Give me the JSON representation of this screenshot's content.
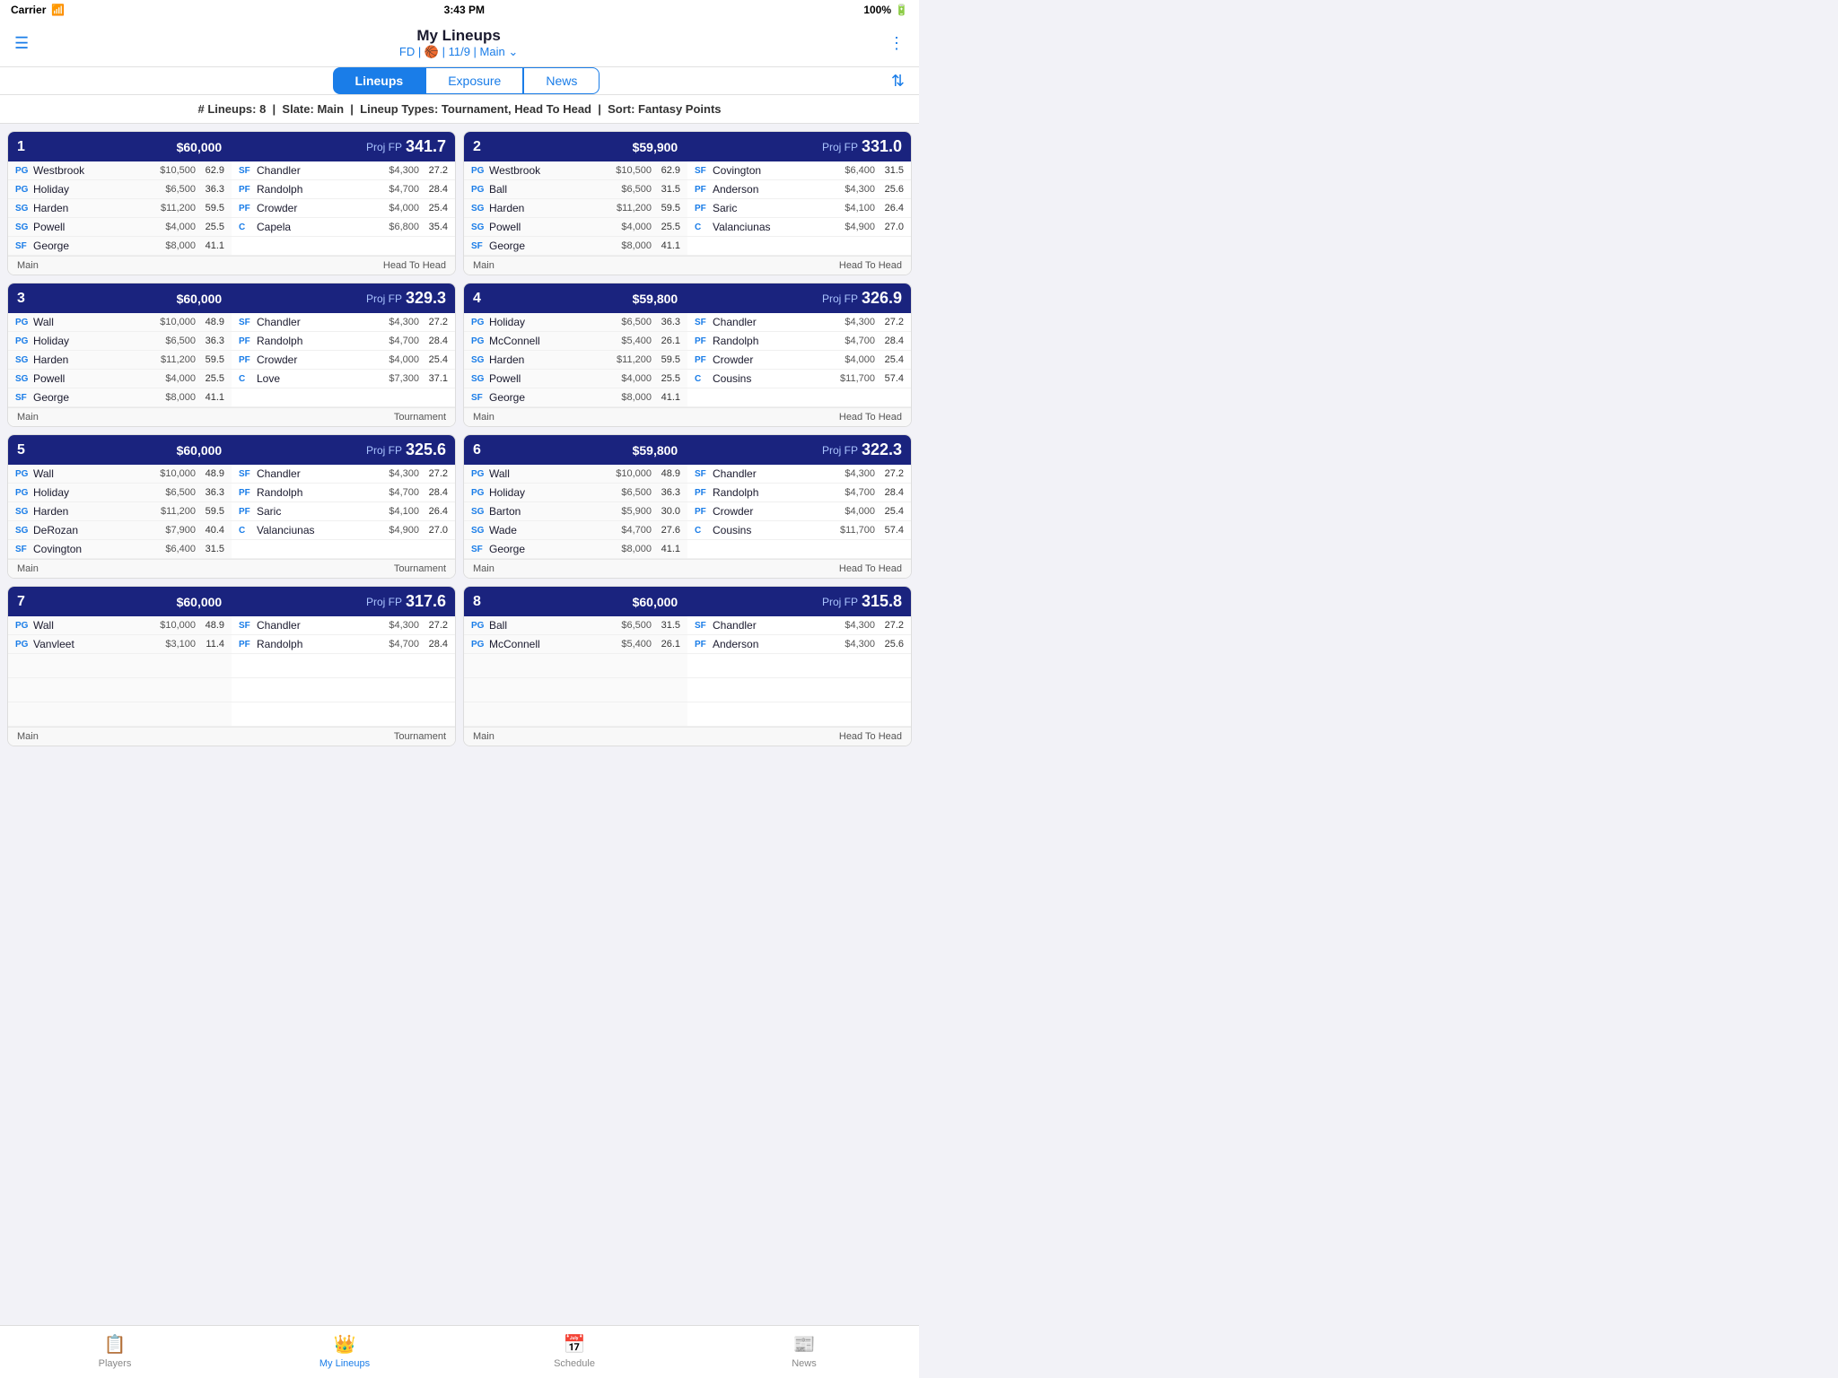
{
  "statusBar": {
    "carrier": "Carrier",
    "time": "3:43 PM",
    "battery": "100%"
  },
  "header": {
    "title": "My Lineups",
    "subtitle": "FD | 🏀 | 11/9 | Main ⌄",
    "menuIcon": "☰",
    "moreIcon": "⋮"
  },
  "tabs": [
    {
      "label": "Lineups",
      "active": true
    },
    {
      "label": "Exposure",
      "active": false
    },
    {
      "label": "News",
      "active": false
    }
  ],
  "filterBar": "# Lineups: 8  |  Slate: Main  |  Lineup Types: Tournament, Head To Head  |  Sort: Fantasy Points",
  "lineups": [
    {
      "num": "1",
      "salary": "$60,000",
      "projFP": "341.7",
      "players": [
        {
          "pos": "PG",
          "name": "Westbrook",
          "salary": "$10,500",
          "fp": "62.9"
        },
        {
          "pos": "PG",
          "name": "Holiday",
          "salary": "$6,500",
          "fp": "36.3"
        },
        {
          "pos": "SG",
          "name": "Harden",
          "salary": "$11,200",
          "fp": "59.5"
        },
        {
          "pos": "SG",
          "name": "Powell",
          "salary": "$4,000",
          "fp": "25.5"
        },
        {
          "pos": "SF",
          "name": "George",
          "salary": "$8,000",
          "fp": "41.1"
        },
        {
          "pos": "SF",
          "name": "Chandler",
          "salary": "$4,300",
          "fp": "27.2"
        },
        {
          "pos": "PF",
          "name": "Randolph",
          "salary": "$4,700",
          "fp": "28.4"
        },
        {
          "pos": "PF",
          "name": "Crowder",
          "salary": "$4,000",
          "fp": "25.4"
        },
        {
          "pos": "C",
          "name": "Capela",
          "salary": "$6,800",
          "fp": "35.4"
        }
      ],
      "slate": "Main",
      "type": "Head To Head"
    },
    {
      "num": "2",
      "salary": "$59,900",
      "projFP": "331.0",
      "players": [
        {
          "pos": "PG",
          "name": "Westbrook",
          "salary": "$10,500",
          "fp": "62.9"
        },
        {
          "pos": "PG",
          "name": "Ball",
          "salary": "$6,500",
          "fp": "31.5"
        },
        {
          "pos": "SG",
          "name": "Harden",
          "salary": "$11,200",
          "fp": "59.5"
        },
        {
          "pos": "SG",
          "name": "Powell",
          "salary": "$4,000",
          "fp": "25.5"
        },
        {
          "pos": "SF",
          "name": "George",
          "salary": "$8,000",
          "fp": "41.1"
        },
        {
          "pos": "SF",
          "name": "Covington",
          "salary": "$6,400",
          "fp": "31.5"
        },
        {
          "pos": "PF",
          "name": "Anderson",
          "salary": "$4,300",
          "fp": "25.6"
        },
        {
          "pos": "PF",
          "name": "Saric",
          "salary": "$4,100",
          "fp": "26.4"
        },
        {
          "pos": "C",
          "name": "Valanciunas",
          "salary": "$4,900",
          "fp": "27.0"
        }
      ],
      "slate": "Main",
      "type": "Head To Head"
    },
    {
      "num": "3",
      "salary": "$60,000",
      "projFP": "329.3",
      "players": [
        {
          "pos": "PG",
          "name": "Wall",
          "salary": "$10,000",
          "fp": "48.9"
        },
        {
          "pos": "PG",
          "name": "Holiday",
          "salary": "$6,500",
          "fp": "36.3"
        },
        {
          "pos": "SG",
          "name": "Harden",
          "salary": "$11,200",
          "fp": "59.5"
        },
        {
          "pos": "SG",
          "name": "Powell",
          "salary": "$4,000",
          "fp": "25.5"
        },
        {
          "pos": "SF",
          "name": "George",
          "salary": "$8,000",
          "fp": "41.1"
        },
        {
          "pos": "SF",
          "name": "Chandler",
          "salary": "$4,300",
          "fp": "27.2"
        },
        {
          "pos": "PF",
          "name": "Randolph",
          "salary": "$4,700",
          "fp": "28.4"
        },
        {
          "pos": "PF",
          "name": "Crowder",
          "salary": "$4,000",
          "fp": "25.4"
        },
        {
          "pos": "C",
          "name": "Love",
          "salary": "$7,300",
          "fp": "37.1"
        }
      ],
      "slate": "Main",
      "type": "Tournament"
    },
    {
      "num": "4",
      "salary": "$59,800",
      "projFP": "326.9",
      "players": [
        {
          "pos": "PG",
          "name": "Holiday",
          "salary": "$6,500",
          "fp": "36.3"
        },
        {
          "pos": "PG",
          "name": "McConnell",
          "salary": "$5,400",
          "fp": "26.1"
        },
        {
          "pos": "SG",
          "name": "Harden",
          "salary": "$11,200",
          "fp": "59.5"
        },
        {
          "pos": "SG",
          "name": "Powell",
          "salary": "$4,000",
          "fp": "25.5"
        },
        {
          "pos": "SF",
          "name": "George",
          "salary": "$8,000",
          "fp": "41.1"
        },
        {
          "pos": "SF",
          "name": "Chandler",
          "salary": "$4,300",
          "fp": "27.2"
        },
        {
          "pos": "PF",
          "name": "Randolph",
          "salary": "$4,700",
          "fp": "28.4"
        },
        {
          "pos": "PF",
          "name": "Crowder",
          "salary": "$4,000",
          "fp": "25.4"
        },
        {
          "pos": "C",
          "name": "Cousins",
          "salary": "$11,700",
          "fp": "57.4"
        }
      ],
      "slate": "Main",
      "type": "Head To Head"
    },
    {
      "num": "5",
      "salary": "$60,000",
      "projFP": "325.6",
      "players": [
        {
          "pos": "PG",
          "name": "Wall",
          "salary": "$10,000",
          "fp": "48.9"
        },
        {
          "pos": "PG",
          "name": "Holiday",
          "salary": "$6,500",
          "fp": "36.3"
        },
        {
          "pos": "SG",
          "name": "Harden",
          "salary": "$11,200",
          "fp": "59.5"
        },
        {
          "pos": "SG",
          "name": "DeRozan",
          "salary": "$7,900",
          "fp": "40.4"
        },
        {
          "pos": "SF",
          "name": "Covington",
          "salary": "$6,400",
          "fp": "31.5"
        },
        {
          "pos": "SF",
          "name": "Chandler",
          "salary": "$4,300",
          "fp": "27.2"
        },
        {
          "pos": "PF",
          "name": "Randolph",
          "salary": "$4,700",
          "fp": "28.4"
        },
        {
          "pos": "PF",
          "name": "Saric",
          "salary": "$4,100",
          "fp": "26.4"
        },
        {
          "pos": "C",
          "name": "Valanciunas",
          "salary": "$4,900",
          "fp": "27.0"
        }
      ],
      "slate": "Main",
      "type": "Tournament"
    },
    {
      "num": "6",
      "salary": "$59,800",
      "projFP": "322.3",
      "players": [
        {
          "pos": "PG",
          "name": "Wall",
          "salary": "$10,000",
          "fp": "48.9"
        },
        {
          "pos": "PG",
          "name": "Holiday",
          "salary": "$6,500",
          "fp": "36.3"
        },
        {
          "pos": "SG",
          "name": "Barton",
          "salary": "$5,900",
          "fp": "30.0"
        },
        {
          "pos": "SG",
          "name": "Wade",
          "salary": "$4,700",
          "fp": "27.6"
        },
        {
          "pos": "SF",
          "name": "George",
          "salary": "$8,000",
          "fp": "41.1"
        },
        {
          "pos": "SF",
          "name": "Chandler",
          "salary": "$4,300",
          "fp": "27.2"
        },
        {
          "pos": "PF",
          "name": "Randolph",
          "salary": "$4,700",
          "fp": "28.4"
        },
        {
          "pos": "PF",
          "name": "Crowder",
          "salary": "$4,000",
          "fp": "25.4"
        },
        {
          "pos": "C",
          "name": "Cousins",
          "salary": "$11,700",
          "fp": "57.4"
        }
      ],
      "slate": "Main",
      "type": "Head To Head"
    },
    {
      "num": "7",
      "salary": "$60,000",
      "projFP": "317.6",
      "players": [
        {
          "pos": "PG",
          "name": "Wall",
          "salary": "$10,000",
          "fp": "48.9"
        },
        {
          "pos": "PG",
          "name": "Vanvleet",
          "salary": "$3,100",
          "fp": "11.4"
        },
        {
          "pos": "SG",
          "name": "",
          "salary": "",
          "fp": ""
        },
        {
          "pos": "SG",
          "name": "",
          "salary": "",
          "fp": ""
        },
        {
          "pos": "SF",
          "name": "",
          "salary": "",
          "fp": ""
        },
        {
          "pos": "SF",
          "name": "Chandler",
          "salary": "$4,300",
          "fp": "27.2"
        },
        {
          "pos": "PF",
          "name": "Randolph",
          "salary": "$4,700",
          "fp": "28.4"
        },
        {
          "pos": "PF",
          "name": "",
          "salary": "",
          "fp": ""
        },
        {
          "pos": "C",
          "name": "",
          "salary": "",
          "fp": ""
        }
      ],
      "slate": "Main",
      "type": "Tournament"
    },
    {
      "num": "8",
      "salary": "$60,000",
      "projFP": "315.8",
      "players": [
        {
          "pos": "PG",
          "name": "Ball",
          "salary": "$6,500",
          "fp": "31.5"
        },
        {
          "pos": "PG",
          "name": "McConnell",
          "salary": "$5,400",
          "fp": "26.1"
        },
        {
          "pos": "SG",
          "name": "",
          "salary": "",
          "fp": ""
        },
        {
          "pos": "SG",
          "name": "",
          "salary": "",
          "fp": ""
        },
        {
          "pos": "SF",
          "name": "",
          "salary": "",
          "fp": ""
        },
        {
          "pos": "SF",
          "name": "Chandler",
          "salary": "$4,300",
          "fp": "27.2"
        },
        {
          "pos": "PF",
          "name": "Anderson",
          "salary": "$4,300",
          "fp": "25.6"
        },
        {
          "pos": "PF",
          "name": "",
          "salary": "",
          "fp": ""
        },
        {
          "pos": "C",
          "name": "",
          "salary": "",
          "fp": ""
        }
      ],
      "slate": "Main",
      "type": "Head To Head"
    }
  ],
  "bottomNav": [
    {
      "label": "Players",
      "icon": "📋",
      "active": false
    },
    {
      "label": "My Lineups",
      "icon": "👑",
      "active": true
    },
    {
      "label": "Schedule",
      "icon": "📅",
      "active": false
    },
    {
      "label": "News",
      "icon": "📰",
      "active": false
    }
  ]
}
